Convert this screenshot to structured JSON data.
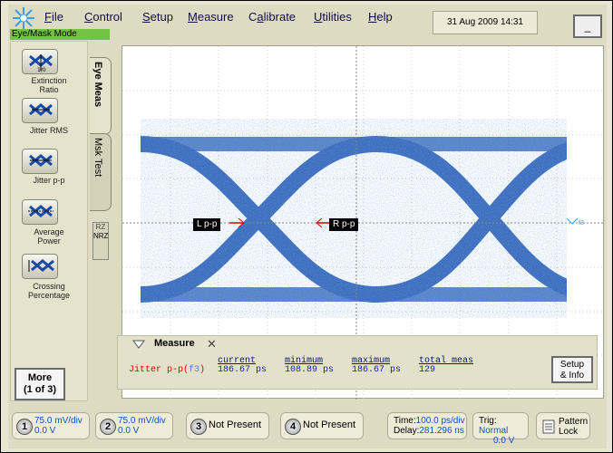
{
  "menu": {
    "items": [
      {
        "label": "File",
        "ul": "F",
        "rest": "ile"
      },
      {
        "label": "Control",
        "ul": "C",
        "rest": "ontrol"
      },
      {
        "label": "Setup",
        "ul": "S",
        "rest": "etup"
      },
      {
        "label": "Measure",
        "ul": "M",
        "rest": "easure"
      },
      {
        "label": "Calibrate",
        "ul": "a",
        "pre": "C",
        "rest": "librate"
      },
      {
        "label": "Utilities",
        "ul": "U",
        "rest": "tilities"
      },
      {
        "label": "Help",
        "ul": "H",
        "rest": "elp"
      }
    ],
    "datetime": "31 Aug 2009  14:31",
    "minimize_label": "_"
  },
  "mode_label": "Eye/Mask Mode",
  "left_panel": {
    "tabs": {
      "eye_meas": "Eye Meas",
      "msk_test": "Msk Test"
    },
    "buttons": [
      {
        "label_1": "Extinction",
        "label_2": "Ratio",
        "icon": "extinction-ratio-icon"
      },
      {
        "label_1": "Jitter RMS",
        "label_2": "",
        "icon": "jitter-rms-icon"
      },
      {
        "label_1": "Jitter p-p",
        "label_2": "",
        "icon": "jitter-pp-icon"
      },
      {
        "label_1": "Average",
        "label_2": "Power",
        "icon": "average-power-icon"
      },
      {
        "label_1": "Crossing",
        "label_2": "Percentage",
        "icon": "crossing-percentage-icon"
      }
    ],
    "more_label_1": "More",
    "more_label_2": "(1 of 3)",
    "rz_label": "RZ",
    "nrz_label": "NRZ"
  },
  "markers": {
    "left": "L p-p",
    "right": "R p-p",
    "channel": "f3"
  },
  "measure": {
    "title": "Measure",
    "headers": {
      "current": "current",
      "minimum": "minimum",
      "maximum": "maximum",
      "total": "total meas"
    },
    "row_name": "Jitter p-p(",
    "row_source": "f3",
    "row_close": ")",
    "current": "186.67 ps",
    "minimum": "108.89 ps",
    "maximum": "186.67 ps",
    "total": "129",
    "setup_label_1": "Setup",
    "setup_label_2": "& Info"
  },
  "bottom": {
    "ch1": {
      "num": "1",
      "scale": "75.0 mV/div",
      "offset": "0.0 V"
    },
    "ch2": {
      "num": "2",
      "scale": "75.0 mV/div",
      "offset": "0.0 V"
    },
    "ch3": {
      "num": "3",
      "status": "Not Present"
    },
    "ch4": {
      "num": "4",
      "status": "Not Present"
    },
    "time_label": "Time:",
    "time_value": "100.0 ps/div",
    "delay_label": "Delay:",
    "delay_value": "281.296 ns",
    "trig_label": "Trig:",
    "trig_value": "Normal",
    "trig_level": "0.0 V",
    "pattern_1": "Pattern",
    "pattern_2": "Lock"
  },
  "colors": {
    "eye_trace": "#2a5fb8",
    "accent_green": "#73c242",
    "marker_red": "#e00000"
  }
}
